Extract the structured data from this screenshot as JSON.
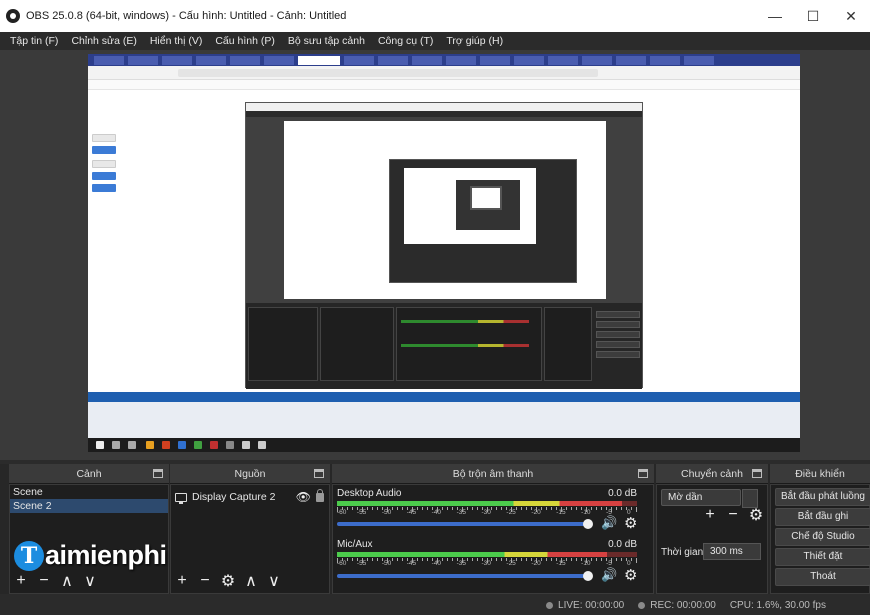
{
  "window": {
    "title": "OBS 25.0.8 (64-bit, windows) - Cấu hình: Untitled - Cảnh: Untitled",
    "minimize": "—",
    "maximize": "☐",
    "close": "✕"
  },
  "menu": [
    "Tập tin (F)",
    "Chỉnh sửa (E)",
    "Hiển thị (V)",
    "Cấu hình (P)",
    "Bộ sưu tập cảnh",
    "Công cụ (T)",
    "Trợ giúp (H)"
  ],
  "docks": {
    "scenes": {
      "title": "Cảnh",
      "items": [
        "Scene",
        "Scene 2"
      ],
      "selected_index": 1
    },
    "sources": {
      "title": "Nguồn",
      "items": [
        {
          "label": "Display Capture 2",
          "icon": "monitor-icon"
        }
      ]
    },
    "mixer": {
      "title": "Bộ trộn âm thanh",
      "channels": [
        {
          "name": "Desktop Audio",
          "db": "0.0 dB",
          "level": 0.95
        },
        {
          "name": "Mic/Aux",
          "db": "0.0 dB",
          "level": 0.9
        }
      ],
      "tick_labels": [
        "-60",
        "-55",
        "-50",
        "-45",
        "-40",
        "-35",
        "-30",
        "-25",
        "-20",
        "-15",
        "-10",
        "-5",
        "0"
      ]
    },
    "transitions": {
      "title": "Chuyển cảnh",
      "selected": "Mờ dần",
      "duration_label": "Thời gian",
      "duration_value": "300 ms"
    },
    "controls": {
      "title": "Điều khiển",
      "buttons": [
        "Bắt đầu phát luồng",
        "Bắt đầu ghi",
        "Chế độ Studio",
        "Thiết đặt",
        "Thoát"
      ]
    }
  },
  "status": {
    "live": "LIVE: 00:00:00",
    "rec": "REC: 00:00:00",
    "cpu": "CPU: 1.6%, 30.00 fps"
  },
  "watermark": {
    "logo_letter": "T",
    "text": "aimienphi"
  },
  "colors": {
    "accent": "#3c6cc9",
    "selected": "#2d4a6e",
    "dock_bg": "#1e1e1e"
  }
}
